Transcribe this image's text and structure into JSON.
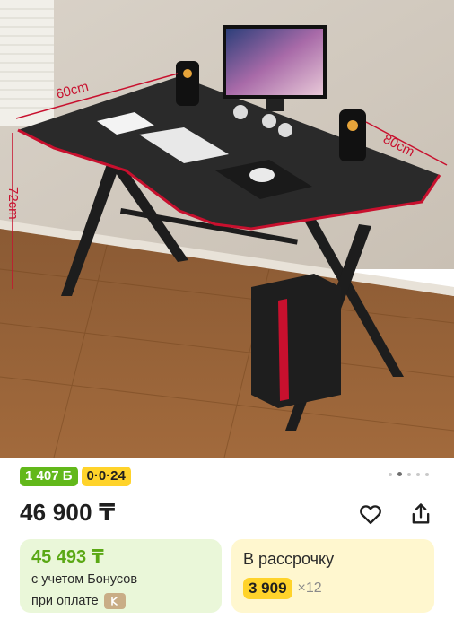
{
  "product": {
    "image": {
      "description_icon": "gaming-desk-photo",
      "dimensions": {
        "width_label": "60cm",
        "length_label": "80cm",
        "height_label": "72cm"
      }
    },
    "badges": {
      "bonus_points": "1 407 Б",
      "installment_code": "0·0·24"
    },
    "gallery": {
      "current_index": 2,
      "total": 5
    },
    "price": "46 900 ₸",
    "actions": {
      "favorite_icon": "heart-icon",
      "share_icon": "share-icon"
    }
  },
  "bonus_card": {
    "price": "45 493 ₸",
    "line1": "с учетом Бонусов",
    "line2": "при оплате",
    "pay_icon": "kaspi-icon",
    "accent_color": "#5aa814",
    "background": "#eaf7d9"
  },
  "installment_card": {
    "title": "В рассрочку",
    "amount": "3 909",
    "multiplier": "×12",
    "accent_color": "#ffd32a",
    "background": "#fff7cf"
  }
}
